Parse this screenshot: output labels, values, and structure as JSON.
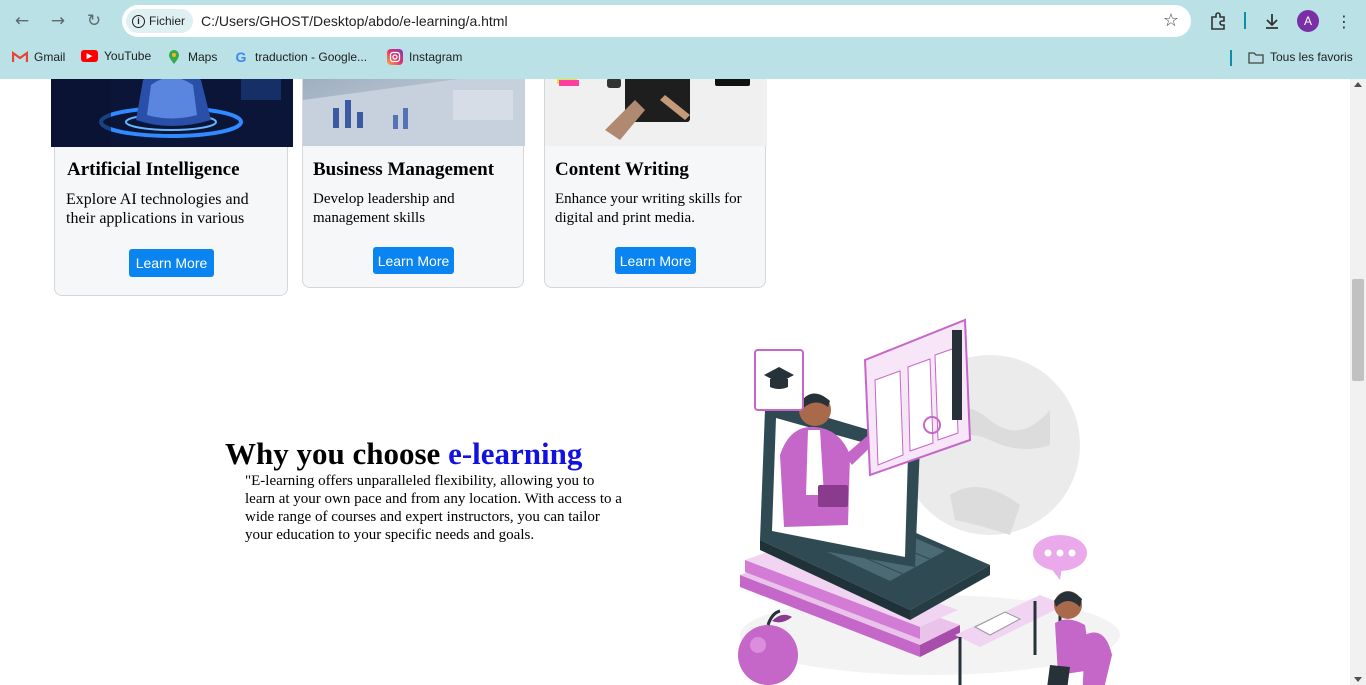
{
  "browser": {
    "site_chip": "Fichier",
    "url": "C:/Users/GHOST/Desktop/abdo/e-learning/a.html",
    "avatar_letter": "A",
    "bookmarks": [
      {
        "label": "Gmail",
        "icon": "gmail-icon"
      },
      {
        "label": "YouTube",
        "icon": "youtube-icon"
      },
      {
        "label": "Maps",
        "icon": "maps-icon"
      },
      {
        "label": "traduction - Google...",
        "icon": "google-icon"
      },
      {
        "label": "Instagram",
        "icon": "instagram-icon"
      }
    ],
    "all_bookmarks": "Tous les favoris"
  },
  "cards": [
    {
      "title": "Artificial Intelligence",
      "description": "Explore AI technologies and their applications in various",
      "button": "Learn More"
    },
    {
      "title": "Business Management",
      "description": "Develop leadership and management skills",
      "button": "Learn More"
    },
    {
      "title": "Content Writing",
      "description": "Enhance your writing skills for digital and print media.",
      "button": "Learn More"
    }
  ],
  "why": {
    "title_prefix": "Why you choose ",
    "title_accent": "e-learning",
    "text": "\"E-learning offers unparalleled flexibility, allowing you to learn at your own pace and from any location. With access to a wide range of courses and expert instructors, you can tailor your education to your specific needs and goals."
  },
  "colors": {
    "chrome_bg": "#b9e1e6",
    "button_blue": "#0a84f0",
    "accent_blue": "#1212e0",
    "illustration_purple": "#c567c8"
  }
}
